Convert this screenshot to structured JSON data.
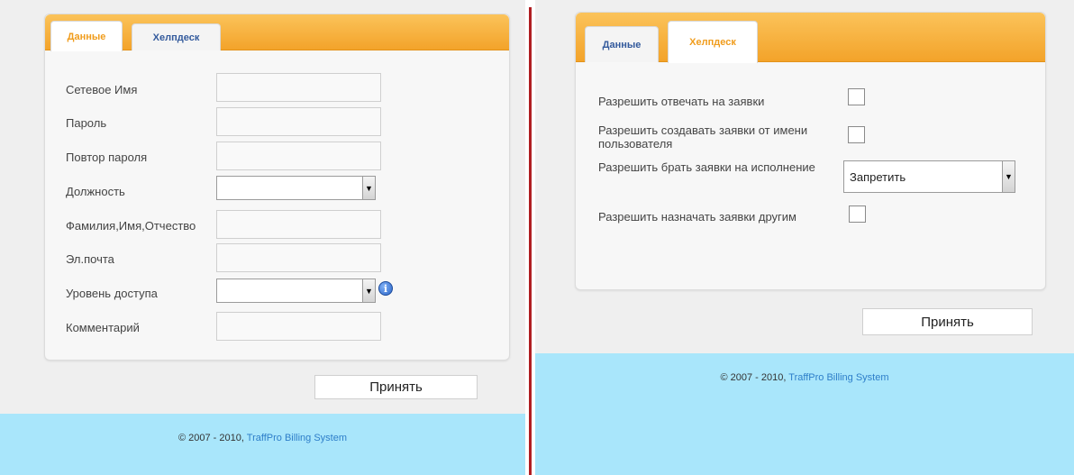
{
  "left": {
    "tabs": [
      {
        "label": "Данные",
        "active": true
      },
      {
        "label": "Хелпдеск",
        "active": false
      }
    ],
    "fields": [
      {
        "label": "Сетевое Имя",
        "type": "text",
        "value": ""
      },
      {
        "label": "Пароль",
        "type": "password",
        "value": ""
      },
      {
        "label": "Повтор пароля",
        "type": "password",
        "value": ""
      },
      {
        "label": "Должность",
        "type": "select",
        "value": ""
      },
      {
        "label": "Фамилия,Имя,Отчество",
        "type": "text",
        "value": ""
      },
      {
        "label": "Эл.почта",
        "type": "text",
        "value": ""
      },
      {
        "label": "Уровень доступа",
        "type": "select",
        "value": ""
      },
      {
        "label": "Комментарий",
        "type": "text",
        "value": ""
      }
    ],
    "submit_label": "Принять",
    "footer": {
      "copyright": "© 2007 - 2010, ",
      "link": "TraffPro Billing System"
    }
  },
  "right": {
    "tabs": [
      {
        "label": "Данные",
        "active": false
      },
      {
        "label": "Хелпдеск",
        "active": true
      }
    ],
    "options": [
      {
        "label": "Разрешить отвечать на заявки",
        "type": "checkbox",
        "checked": false
      },
      {
        "label": "Разрешить создавать заявки от имени пользователя",
        "type": "checkbox",
        "checked": false
      },
      {
        "label": "Разрешить брать заявки на исполнение",
        "type": "select",
        "value": "Запретить"
      },
      {
        "label": "Разрешить назначать заявки другим",
        "type": "checkbox",
        "checked": false
      }
    ],
    "submit_label": "Принять",
    "footer": {
      "copyright": "© 2007 - 2010, ",
      "link": "TraffPro Billing System"
    }
  },
  "colors": {
    "tab_bar": "#f3a32a",
    "active_tab_text": "#f09c1c",
    "tab_text": "#335a9c",
    "footer_bg": "#a9e6fb",
    "divider": "#b01e22",
    "link": "#2d7ec9"
  },
  "icons": {
    "select_arrow": "▼",
    "info": "i"
  }
}
